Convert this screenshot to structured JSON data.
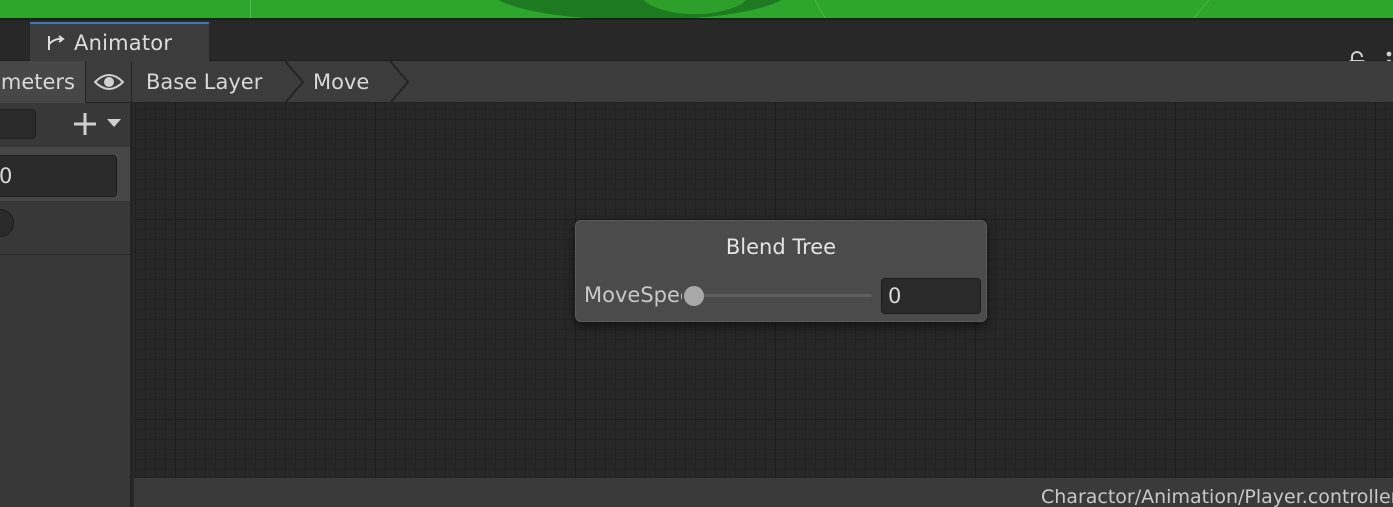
{
  "window": {
    "tab_label": "Animator",
    "tab_icon": "animator-icon"
  },
  "toolbar": {
    "parameters_tab_label": "meters",
    "breadcrumbs": [
      {
        "label": "Base Layer"
      },
      {
        "label": "Move"
      }
    ]
  },
  "left_panel": {
    "parameter_value": "0"
  },
  "node": {
    "title": "Blend Tree",
    "parameter_label": "MoveSpeed",
    "parameter_value": "0",
    "slider_fraction": 0
  },
  "status_bar": {
    "asset_path": "Charactor/Animation/Player.controller"
  },
  "colors": {
    "scene_green": "#2ea52d",
    "tab_accent": "#3a79bb",
    "panel_bg": "#3c3c3c",
    "graph_bg": "#272727",
    "node_bg": "#4b4b4b"
  }
}
